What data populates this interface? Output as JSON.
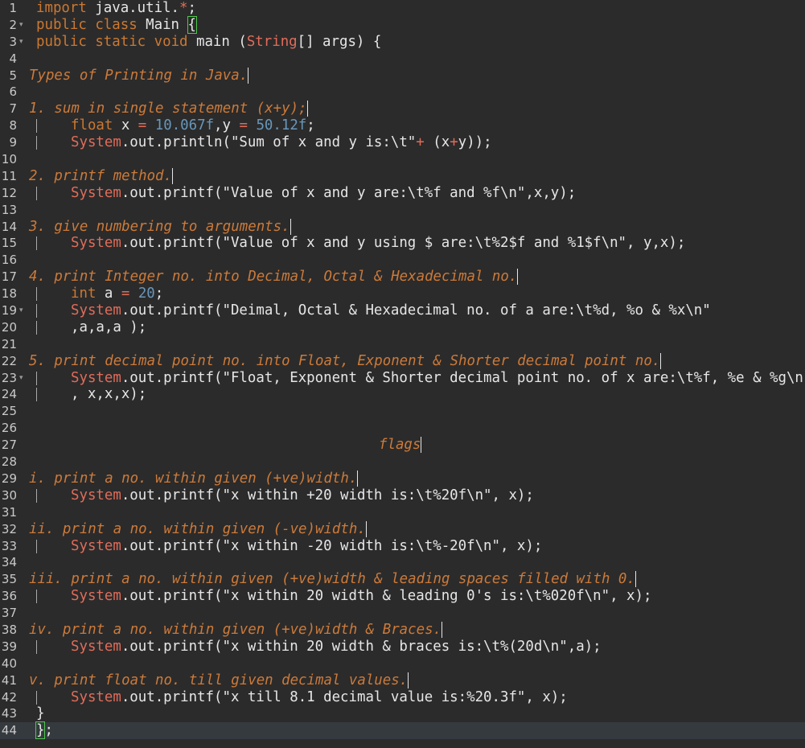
{
  "editor": {
    "lines": [
      {
        "n": "1",
        "fold": false,
        "guide": false,
        "indent": 45,
        "tokens": [
          {
            "t": "import",
            "c": "kw"
          },
          {
            "t": " java.util."
          },
          {
            "t": "*",
            "c": "op"
          },
          {
            "t": ";"
          }
        ]
      },
      {
        "n": "2",
        "fold": true,
        "guide": false,
        "indent": 45,
        "tokens": [
          {
            "t": "public",
            "c": "kw"
          },
          {
            "t": " "
          },
          {
            "t": "class",
            "c": "kw"
          },
          {
            "t": " Main "
          },
          {
            "t": "{",
            "c": "brace-hl"
          }
        ]
      },
      {
        "n": "3",
        "fold": true,
        "guide": false,
        "indent": 45,
        "tokens": [
          {
            "t": "public",
            "c": "kw"
          },
          {
            "t": " "
          },
          {
            "t": "static",
            "c": "kw"
          },
          {
            "t": " "
          },
          {
            "t": "void",
            "c": "kw"
          },
          {
            "t": " main ("
          },
          {
            "t": "String",
            "c": "cls"
          },
          {
            "t": "[] args) {"
          }
        ]
      },
      {
        "n": "4",
        "fold": false,
        "guide": false,
        "indent": 45,
        "tokens": []
      },
      {
        "n": "5",
        "fold": false,
        "guide": false,
        "indent": 36,
        "tokens": [
          {
            "t": "Types of Printing in Java.",
            "c": "cmt cursor"
          }
        ]
      },
      {
        "n": "6",
        "fold": false,
        "guide": false,
        "indent": 36,
        "tokens": []
      },
      {
        "n": "7",
        "fold": false,
        "guide": false,
        "indent": 36,
        "tokens": [
          {
            "t": "1. sum in single statement (x+y);",
            "c": "cmt cursor"
          }
        ]
      },
      {
        "n": "8",
        "fold": false,
        "guide": true,
        "indent": 88,
        "tokens": [
          {
            "t": "float",
            "c": "kw"
          },
          {
            "t": " x "
          },
          {
            "t": "=",
            "c": "op"
          },
          {
            "t": " "
          },
          {
            "t": "10.067f",
            "c": "num"
          },
          {
            "t": ",y "
          },
          {
            "t": "=",
            "c": "op"
          },
          {
            "t": " "
          },
          {
            "t": "50.12f",
            "c": "num"
          },
          {
            "t": ";"
          }
        ]
      },
      {
        "n": "9",
        "fold": false,
        "guide": true,
        "indent": 88,
        "tokens": [
          {
            "t": "System",
            "c": "cls"
          },
          {
            "t": ".out.println(\"Sum of x and y is:\\t\""
          },
          {
            "t": "+",
            "c": "op"
          },
          {
            "t": " (x"
          },
          {
            "t": "+",
            "c": "op"
          },
          {
            "t": "y));"
          }
        ]
      },
      {
        "n": "10",
        "fold": false,
        "guide": false,
        "indent": 36,
        "tokens": []
      },
      {
        "n": "11",
        "fold": false,
        "guide": false,
        "indent": 36,
        "tokens": [
          {
            "t": "2. printf method.",
            "c": "cmt cursor"
          }
        ]
      },
      {
        "n": "12",
        "fold": false,
        "guide": true,
        "indent": 88,
        "tokens": [
          {
            "t": "System",
            "c": "cls"
          },
          {
            "t": ".out.printf(\"Value of x and y are:\\t%f and %f\\n\",x,y);"
          }
        ]
      },
      {
        "n": "13",
        "fold": false,
        "guide": false,
        "indent": 36,
        "tokens": []
      },
      {
        "n": "14",
        "fold": false,
        "guide": false,
        "indent": 36,
        "tokens": [
          {
            "t": "3. give numbering to arguments.",
            "c": "cmt cursor"
          }
        ]
      },
      {
        "n": "15",
        "fold": false,
        "guide": true,
        "indent": 88,
        "tokens": [
          {
            "t": "System",
            "c": "cls"
          },
          {
            "t": ".out.printf(\"Value of x and y using $ are:\\t%2$f and %1$f\\n\", y,x);"
          }
        ]
      },
      {
        "n": "16",
        "fold": false,
        "guide": false,
        "indent": 36,
        "tokens": []
      },
      {
        "n": "17",
        "fold": false,
        "guide": false,
        "indent": 36,
        "tokens": [
          {
            "t": "4. print Integer no. into Decimal, Octal & Hexadecimal no.",
            "c": "cmt cursor"
          }
        ]
      },
      {
        "n": "18",
        "fold": false,
        "guide": true,
        "indent": 88,
        "tokens": [
          {
            "t": "int",
            "c": "kw"
          },
          {
            "t": " a "
          },
          {
            "t": "=",
            "c": "op"
          },
          {
            "t": " "
          },
          {
            "t": "20",
            "c": "num"
          },
          {
            "t": ";"
          }
        ]
      },
      {
        "n": "19",
        "fold": true,
        "guide": true,
        "indent": 88,
        "tokens": [
          {
            "t": "System",
            "c": "cls"
          },
          {
            "t": ".out.printf(\"Deimal, Octal & Hexadecimal no. of a are:\\t%d, %o & %x\\n\""
          }
        ]
      },
      {
        "n": "20",
        "fold": false,
        "guide": true,
        "indent": 88,
        "tokens": [
          {
            "t": ",a,a,a );"
          }
        ]
      },
      {
        "n": "21",
        "fold": false,
        "guide": false,
        "indent": 36,
        "tokens": []
      },
      {
        "n": "22",
        "fold": false,
        "guide": false,
        "indent": 36,
        "tokens": [
          {
            "t": "5. print decimal point no. into Float, Exponent & Shorter decimal point no.",
            "c": "cmt cursor"
          }
        ]
      },
      {
        "n": "23",
        "fold": true,
        "guide": true,
        "indent": 88,
        "tokens": [
          {
            "t": "System",
            "c": "cls"
          },
          {
            "t": ".out.printf(\"Float, Exponent & Shorter decimal point no. of x are:\\t%f, %e & %g\\n"
          }
        ]
      },
      {
        "n": "24",
        "fold": false,
        "guide": true,
        "indent": 88,
        "tokens": [
          {
            "t": ", x,x,x);"
          }
        ]
      },
      {
        "n": "25",
        "fold": false,
        "guide": false,
        "indent": 36,
        "tokens": []
      },
      {
        "n": "26",
        "fold": false,
        "guide": false,
        "indent": 36,
        "tokens": []
      },
      {
        "n": "27",
        "fold": false,
        "guide": false,
        "indent": 471,
        "tokens": [
          {
            "t": "flags",
            "c": "cmt cursor"
          }
        ]
      },
      {
        "n": "28",
        "fold": false,
        "guide": false,
        "indent": 36,
        "tokens": []
      },
      {
        "n": "29",
        "fold": false,
        "guide": false,
        "indent": 36,
        "tokens": [
          {
            "t": "i. print a no. within given (+ve)width.",
            "c": "cmt cursor"
          }
        ]
      },
      {
        "n": "30",
        "fold": false,
        "guide": true,
        "indent": 88,
        "tokens": [
          {
            "t": "System",
            "c": "cls"
          },
          {
            "t": ".out.printf(\"x within +20 width is:\\t%20f\\n\", x);"
          }
        ]
      },
      {
        "n": "31",
        "fold": false,
        "guide": false,
        "indent": 36,
        "tokens": []
      },
      {
        "n": "32",
        "fold": false,
        "guide": false,
        "indent": 36,
        "tokens": [
          {
            "t": "ii. print a no. within given (-ve)width.",
            "c": "cmt cursor"
          }
        ]
      },
      {
        "n": "33",
        "fold": false,
        "guide": true,
        "indent": 88,
        "tokens": [
          {
            "t": "System",
            "c": "cls"
          },
          {
            "t": ".out.printf(\"x within -20 width is:\\t%-20f\\n\", x);"
          }
        ]
      },
      {
        "n": "34",
        "fold": false,
        "guide": false,
        "indent": 36,
        "tokens": []
      },
      {
        "n": "35",
        "fold": false,
        "guide": false,
        "indent": 36,
        "tokens": [
          {
            "t": "iii. print a no. within given (+ve)width & leading spaces filled with 0.",
            "c": "cmt cursor"
          }
        ]
      },
      {
        "n": "36",
        "fold": false,
        "guide": true,
        "indent": 88,
        "tokens": [
          {
            "t": "System",
            "c": "cls"
          },
          {
            "t": ".out.printf(\"x within 20 width & leading 0's is:\\t%020f\\n\", x);"
          }
        ]
      },
      {
        "n": "37",
        "fold": false,
        "guide": false,
        "indent": 36,
        "tokens": []
      },
      {
        "n": "38",
        "fold": false,
        "guide": false,
        "indent": 36,
        "tokens": [
          {
            "t": "iv. print a no. within given (+ve)width & Braces.",
            "c": "cmt cursor"
          }
        ]
      },
      {
        "n": "39",
        "fold": false,
        "guide": true,
        "indent": 88,
        "tokens": [
          {
            "t": "System",
            "c": "cls"
          },
          {
            "t": ".out.printf(\"x within 20 width & braces is:\\t%(20d\\n\",a);"
          }
        ]
      },
      {
        "n": "40",
        "fold": false,
        "guide": false,
        "indent": 36,
        "tokens": []
      },
      {
        "n": "41",
        "fold": false,
        "guide": false,
        "indent": 36,
        "tokens": [
          {
            "t": "v. print float no. till given decimal values.",
            "c": "cmt cursor"
          }
        ]
      },
      {
        "n": "42",
        "fold": false,
        "guide": true,
        "indent": 88,
        "tokens": [
          {
            "t": "System",
            "c": "cls"
          },
          {
            "t": ".out.printf(\"x till 8.1 decimal value is:%20.3f\", x);"
          }
        ]
      },
      {
        "n": "43",
        "fold": false,
        "guide": false,
        "indent": 45,
        "tokens": [
          {
            "t": "}"
          }
        ]
      },
      {
        "n": "44",
        "fold": false,
        "guide": false,
        "indent": 45,
        "active": true,
        "tokens": [
          {
            "t": "}",
            "c": "brace-hl"
          },
          {
            "t": ";"
          }
        ]
      }
    ]
  },
  "colors": {
    "background": "#2b2b2b",
    "text": "#e6e6e6",
    "keyword": "#cc7832",
    "class": "#e06c5a",
    "number": "#6897bb",
    "comment": "#cc7a3a",
    "bracket_match": "#4ec94e",
    "active_line": "#353a3f"
  }
}
